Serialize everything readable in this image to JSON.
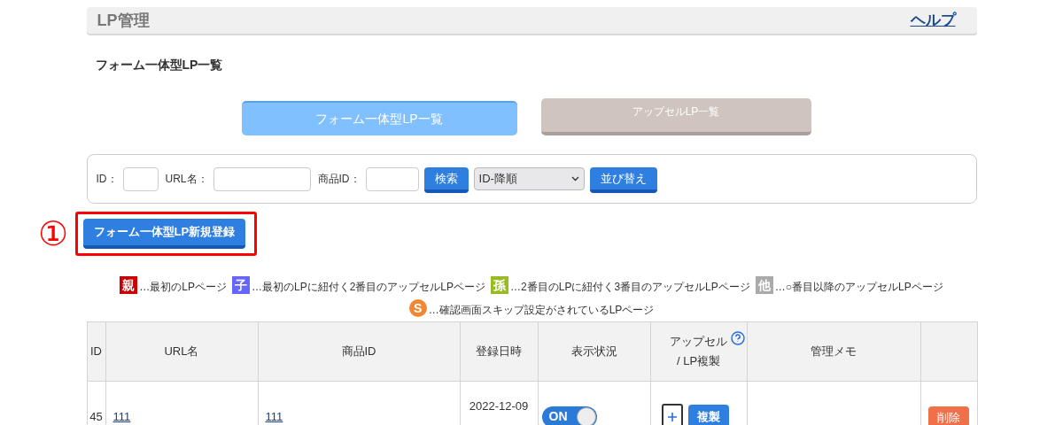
{
  "header": {
    "title": "LP管理",
    "help_link": "ヘルプ"
  },
  "section_title": "フォーム一体型LP一覧",
  "tabs": [
    {
      "label": "フォーム一体型LP一覧",
      "selected": true
    },
    {
      "label": "アップセルLP一覧",
      "selected": false
    }
  ],
  "search": {
    "fields": [
      {
        "label": "ID："
      },
      {
        "label": "URL名："
      },
      {
        "label": "商品ID："
      }
    ],
    "search_button": "検索",
    "sort_select": "ID-降順",
    "sort_button": "並び替え"
  },
  "annotation": {
    "marker": "①"
  },
  "new_button": "フォーム一体型LP新規登録",
  "legend": [
    {
      "kind": "square",
      "badge": "親",
      "color": "#cc0000",
      "text": "…最初のLPページ"
    },
    {
      "kind": "square",
      "badge": "子",
      "color": "#6666ff",
      "text": "…最初のLPに紐付く2番目のアップセルLPページ"
    },
    {
      "kind": "square",
      "badge": "孫",
      "color": "#99bb22",
      "text": "…2番目のLPに紐付く3番目のアップセルLPページ"
    },
    {
      "kind": "square",
      "badge": "他",
      "color": "#aaaaaa",
      "text": "…○番目以降のアップセルLPページ"
    },
    {
      "kind": "circle",
      "badge": "S",
      "color": "#ee8833",
      "text": "…確認画面スキップ設定がされているLPページ"
    }
  ],
  "table": {
    "columns": [
      "ID",
      "URL名",
      "商品ID",
      "登録日時",
      "表示状況",
      "アップセル\n/ LP複製",
      "管理メモ"
    ],
    "rows": [
      {
        "id": "45",
        "url_name": "111",
        "product_id": "111",
        "registered": "2022-12-09",
        "status": {
          "label": "ON",
          "on": true
        },
        "copy_button": "複製",
        "delete_button": "削除"
      }
    ]
  }
}
